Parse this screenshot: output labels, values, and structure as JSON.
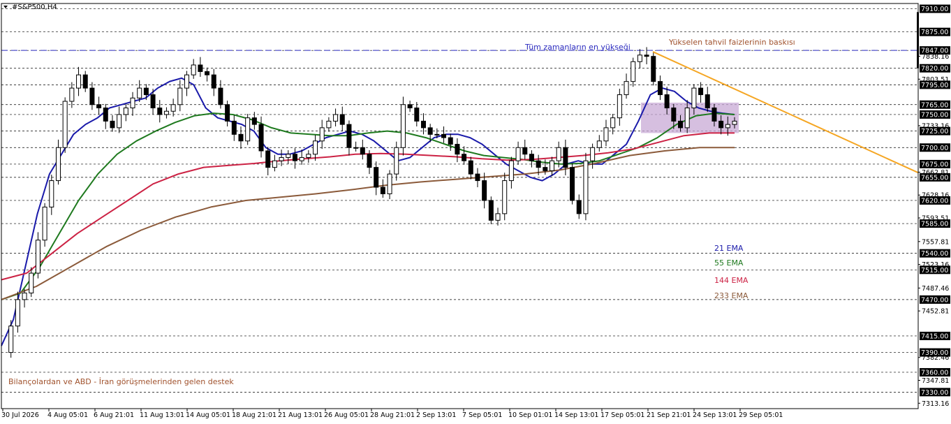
{
  "window": {
    "symbol_label": "#S&P500,H4",
    "menu_icon": "triangle-down-icon"
  },
  "colors": {
    "background": "#ffffff",
    "candle": "#000000",
    "ema21": "#1a1aaa",
    "ema55": "#1f7a1f",
    "ema144": "#cc2244",
    "ema233": "#8b5a3a",
    "trendline": "#f5a623",
    "consolidation_box": "#c8a9d6",
    "ath_line": "#2b2bbf",
    "annotation_brown": "#a0522d",
    "annotation_blue": "#2b2bbf",
    "price_box": "#000000"
  },
  "chart_data": {
    "type": "candlestick",
    "ylim": [
      7305,
      7918
    ],
    "price_axis_ticks": [
      "7910.00",
      "7875.00",
      "7847.00",
      "7838.16",
      "7820.00",
      "7803.51",
      "7795.00",
      "7765.00",
      "7750.00",
      "7733.16",
      "7725.00",
      "7700.00",
      "7675.00",
      "7662.81",
      "7655.00",
      "7628.16",
      "7620.00",
      "7593.51",
      "7585.00",
      "7557.81",
      "7540.00",
      "7523.16",
      "7515.00",
      "7487.46",
      "7470.00",
      "7452.81",
      "7415.00",
      "7390.00",
      "7382.46",
      "7360.00",
      "7347.81",
      "7330.00",
      "7313.16"
    ],
    "highlighted_levels": [
      "7910.00",
      "7875.00",
      "7847.00",
      "7820.00",
      "7795.00",
      "7765.00",
      "7750.00",
      "7725.00",
      "7700.00",
      "7675.00",
      "7655.00",
      "7620.00",
      "7585.00",
      "7540.00",
      "7515.00",
      "7470.00",
      "7415.00",
      "7390.00",
      "7360.00",
      "7330.00"
    ],
    "time_axis_labels": [
      "30 Jul 2026",
      "4 Aug 05:01",
      "6 Aug 21:01",
      "11 Aug 13:01",
      "14 Aug 05:01",
      "18 Aug 21:01",
      "21 Aug 13:01",
      "26 Aug 05:01",
      "28 Aug 21:01",
      "2 Sep 13:01",
      "7 Sep 05:01",
      "10 Sep 01:01",
      "14 Sep 13:01",
      "17 Sep 05:01",
      "21 Sep 21:01",
      "24 Sep 13:01",
      "29 Sep 05:01"
    ],
    "close_path": [
      7390,
      7430,
      7470,
      7480,
      7510,
      7560,
      7610,
      7650,
      7700,
      7770,
      7790,
      7810,
      7790,
      7765,
      7760,
      7740,
      7730,
      7750,
      7760,
      7775,
      7790,
      7780,
      7760,
      7750,
      7755,
      7765,
      7790,
      7810,
      7825,
      7815,
      7810,
      7790,
      7765,
      7740,
      7720,
      7710,
      7745,
      7735,
      7695,
      7670,
      7680,
      7685,
      7690,
      7680,
      7685,
      7690,
      7710,
      7730,
      7740,
      7750,
      7735,
      7700,
      7700,
      7690,
      7670,
      7640,
      7630,
      7660,
      7700,
      7765,
      7760,
      7740,
      7730,
      7720,
      7720,
      7715,
      7705,
      7690,
      7680,
      7660,
      7650,
      7620,
      7590,
      7600,
      7650,
      7680,
      7700,
      7690,
      7680,
      7670,
      7665,
      7680,
      7700,
      7670,
      7620,
      7600,
      7680,
      7700,
      7710,
      7730,
      7745,
      7780,
      7800,
      7830,
      7840,
      7838,
      7800,
      7780,
      7760,
      7740,
      7730,
      7760,
      7790,
      7780,
      7760,
      7740,
      7730,
      7735,
      7740
    ],
    "ema_series": [
      {
        "name": "21 EMA",
        "values": [
          7400,
          7440,
          7520,
          7600,
          7660,
          7690,
          7720,
          7735,
          7745,
          7760,
          7765,
          7770,
          7775,
          7790,
          7800,
          7805,
          7795,
          7760,
          7745,
          7740,
          7735,
          7725,
          7700,
          7690,
          7690,
          7695,
          7705,
          7715,
          7720,
          7725,
          7720,
          7710,
          7695,
          7680,
          7685,
          7700,
          7715,
          7720,
          7720,
          7715,
          7705,
          7690,
          7675,
          7665,
          7655,
          7650,
          7660,
          7675,
          7680,
          7675,
          7675,
          7690,
          7705,
          7740,
          7780,
          7790,
          7785,
          7770,
          7760,
          7755,
          7752,
          7750
        ]
      },
      {
        "name": "55 EMA",
        "values": [
          7470,
          7480,
          7520,
          7570,
          7620,
          7660,
          7690,
          7710,
          7725,
          7738,
          7748,
          7752,
          7750,
          7742,
          7730,
          7722,
          7720,
          7718,
          7718,
          7722,
          7725,
          7722,
          7715,
          7705,
          7695,
          7688,
          7685,
          7682,
          7678,
          7675,
          7676,
          7680,
          7690,
          7700,
          7715,
          7735,
          7748,
          7752,
          7750
        ]
      },
      {
        "name": "144 EMA",
        "values": [
          7500,
          7510,
          7540,
          7570,
          7595,
          7620,
          7645,
          7660,
          7670,
          7673,
          7676,
          7680,
          7683,
          7686,
          7690,
          7691,
          7690,
          7688,
          7686,
          7683,
          7681,
          7682,
          7685,
          7688,
          7692,
          7698,
          7708,
          7718,
          7722,
          7722
        ]
      },
      {
        "name": "233 EMA",
        "values": [
          7470,
          7490,
          7520,
          7550,
          7575,
          7595,
          7610,
          7620,
          7625,
          7630,
          7636,
          7643,
          7648,
          7652,
          7656,
          7660,
          7666,
          7676,
          7688,
          7695,
          7700,
          7700
        ]
      }
    ],
    "last_price_marker": "7820.00"
  },
  "annotations": {
    "ath_label": "Tüm zamanların en yükseği",
    "yield_label": "Yükselen tahvil faizlerinin baskısı",
    "earnings_label": "Bilançolardan ve ABD - İran görüşmelerinden gelen destek",
    "legend": [
      {
        "label": "21 EMA",
        "color": "#1a1aaa"
      },
      {
        "label": "55 EMA",
        "color": "#1f7a1f"
      },
      {
        "label": "144 EMA",
        "color": "#cc2244"
      },
      {
        "label": "233 EMA",
        "color": "#8b5a3a"
      }
    ]
  }
}
